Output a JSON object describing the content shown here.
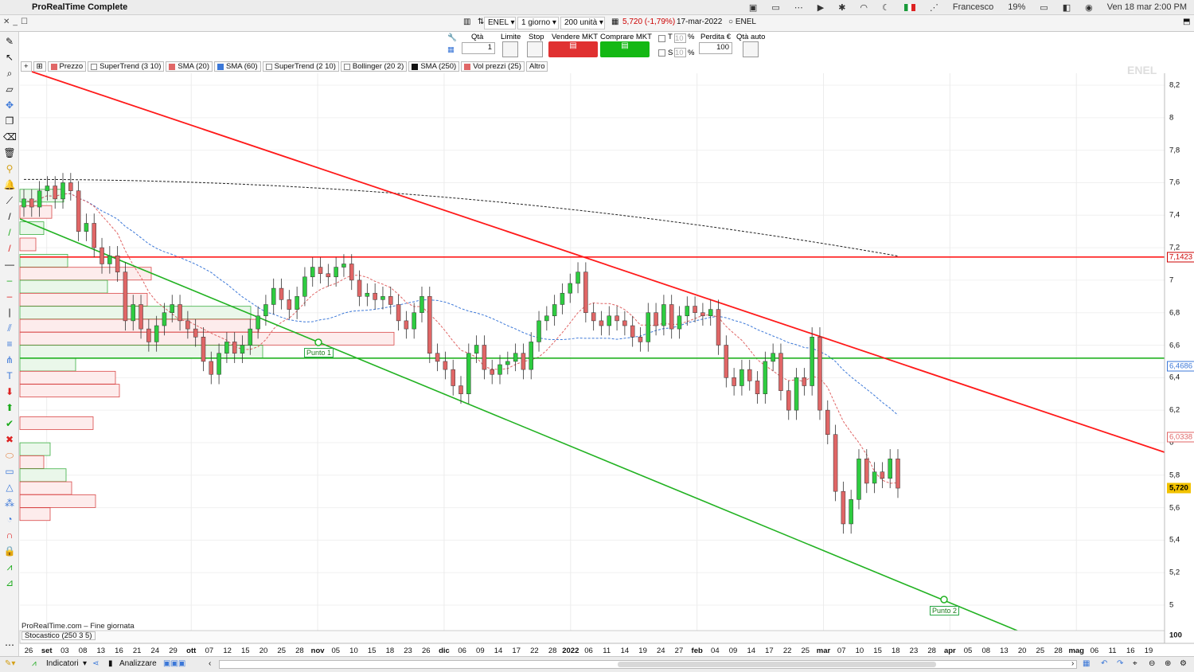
{
  "menubar": {
    "app_name": "ProRealTime Complete",
    "user": "Francesco",
    "battery": "19%",
    "datetime": "Ven 18 mar  2:00 PM"
  },
  "toolbar": {
    "symbol": "ENEL",
    "timeframe": "1 giorno",
    "units": "200 unità",
    "quote": "5,720 (-1,79%)",
    "quote_color": "#cc0000",
    "date": "17-mar-2022",
    "instrument": "ENEL"
  },
  "order": {
    "qty_label": "Qtà",
    "qty_value": "1",
    "limit_label": "Limite",
    "stop_label": "Stop",
    "sell_label": "Vendere MKT",
    "buy_label": "Comprare MKT",
    "t_label": "T",
    "s_label": "S",
    "t_value": "10",
    "s_value": "10",
    "pct": "%",
    "loss_label": "Perdita €",
    "loss_value": "100",
    "auto_qty_label": "Qtà auto"
  },
  "legend": [
    {
      "label": "Prezzo",
      "color": "#e06666"
    },
    {
      "label": "SuperTrend (3 10)",
      "color": "#ffffff"
    },
    {
      "label": "SMA (20)",
      "color": "#e06666"
    },
    {
      "label": "SMA (60)",
      "color": "#3c78d8"
    },
    {
      "label": "SuperTrend (2 10)",
      "color": "#ffffff"
    },
    {
      "label": "Bollinger (20 2)",
      "color": "#ffffff"
    },
    {
      "label": "SMA (250)",
      "color": "#111111"
    },
    {
      "label": "Vol prezzi (25)",
      "color": "#e06666"
    },
    {
      "label": "Altro",
      "color": ""
    }
  ],
  "watermark": "ENEL",
  "footer": {
    "source": "ProRealTime.com – Fine giornata",
    "stochastic": "Stocastico (250 3 5)",
    "stoch_value": "100"
  },
  "bottombar": {
    "indicators": "Indicatori",
    "analyzer": "Analizzare"
  },
  "annotations": {
    "point1": "Punto 1",
    "point2": "Punto 2"
  },
  "chart_data": {
    "type": "candlestick",
    "title": "",
    "ylim": [
      4.9,
      8.3
    ],
    "y_ticks": [
      "8,2",
      "8",
      "7,8",
      "7,6",
      "7,4",
      "7,2",
      "7",
      "6,8",
      "6,6",
      "6,4",
      "6,2",
      "6",
      "5,8",
      "5,6",
      "5,4",
      "5,2",
      "5"
    ],
    "y_tags": [
      {
        "label": "7,1423",
        "value": 7.1423,
        "color": "#cc0000"
      },
      {
        "label": "6,4686",
        "value": 6.4686,
        "color": "#3c78d8"
      },
      {
        "label": "6,0338",
        "value": 6.0338,
        "color": "#e06666"
      },
      {
        "label": "5,720",
        "value": 5.72,
        "color": "#f2c200"
      }
    ],
    "x_ticks": [
      {
        "label": "26",
        "bold": false
      },
      {
        "label": "set",
        "bold": true
      },
      {
        "label": "03",
        "bold": false
      },
      {
        "label": "08",
        "bold": false
      },
      {
        "label": "13",
        "bold": false
      },
      {
        "label": "16",
        "bold": false
      },
      {
        "label": "21",
        "bold": false
      },
      {
        "label": "24",
        "bold": false
      },
      {
        "label": "29",
        "bold": false
      },
      {
        "label": "ott",
        "bold": true
      },
      {
        "label": "07",
        "bold": false
      },
      {
        "label": "12",
        "bold": false
      },
      {
        "label": "15",
        "bold": false
      },
      {
        "label": "20",
        "bold": false
      },
      {
        "label": "25",
        "bold": false
      },
      {
        "label": "28",
        "bold": false
      },
      {
        "label": "nov",
        "bold": true
      },
      {
        "label": "05",
        "bold": false
      },
      {
        "label": "10",
        "bold": false
      },
      {
        "label": "15",
        "bold": false
      },
      {
        "label": "18",
        "bold": false
      },
      {
        "label": "23",
        "bold": false
      },
      {
        "label": "26",
        "bold": false
      },
      {
        "label": "dic",
        "bold": true
      },
      {
        "label": "06",
        "bold": false
      },
      {
        "label": "09",
        "bold": false
      },
      {
        "label": "14",
        "bold": false
      },
      {
        "label": "17",
        "bold": false
      },
      {
        "label": "22",
        "bold": false
      },
      {
        "label": "28",
        "bold": false
      },
      {
        "label": "2022",
        "bold": true
      },
      {
        "label": "06",
        "bold": false
      },
      {
        "label": "11",
        "bold": false
      },
      {
        "label": "14",
        "bold": false
      },
      {
        "label": "19",
        "bold": false
      },
      {
        "label": "24",
        "bold": false
      },
      {
        "label": "27",
        "bold": false
      },
      {
        "label": "feb",
        "bold": true
      },
      {
        "label": "04",
        "bold": false
      },
      {
        "label": "09",
        "bold": false
      },
      {
        "label": "14",
        "bold": false
      },
      {
        "label": "17",
        "bold": false
      },
      {
        "label": "22",
        "bold": false
      },
      {
        "label": "25",
        "bold": false
      },
      {
        "label": "mar",
        "bold": true
      },
      {
        "label": "07",
        "bold": false
      },
      {
        "label": "10",
        "bold": false
      },
      {
        "label": "15",
        "bold": false
      },
      {
        "label": "18",
        "bold": false
      },
      {
        "label": "23",
        "bold": false
      },
      {
        "label": "28",
        "bold": false
      },
      {
        "label": "apr",
        "bold": true
      },
      {
        "label": "05",
        "bold": false
      },
      {
        "label": "08",
        "bold": false
      },
      {
        "label": "13",
        "bold": false
      },
      {
        "label": "20",
        "bold": false
      },
      {
        "label": "25",
        "bold": false
      },
      {
        "label": "28",
        "bold": false
      },
      {
        "label": "mag",
        "bold": true
      },
      {
        "label": "06",
        "bold": false
      },
      {
        "label": "11",
        "bold": false
      },
      {
        "label": "16",
        "bold": false
      },
      {
        "label": "19",
        "bold": false
      }
    ],
    "closes": [
      7.5,
      7.45,
      7.55,
      7.58,
      7.5,
      7.6,
      7.55,
      7.3,
      7.35,
      7.2,
      7.1,
      7.15,
      7.05,
      6.75,
      6.85,
      6.7,
      6.62,
      6.72,
      6.8,
      6.85,
      6.75,
      6.7,
      6.65,
      6.5,
      6.42,
      6.55,
      6.62,
      6.55,
      6.6,
      6.7,
      6.78,
      6.85,
      6.95,
      6.88,
      6.82,
      6.9,
      7.02,
      7.08,
      7.04,
      7.02,
      7.08,
      7.1,
      7.0,
      6.9,
      6.92,
      6.88,
      6.9,
      6.85,
      6.75,
      6.7,
      6.8,
      6.9,
      6.55,
      6.5,
      6.45,
      6.35,
      6.3,
      6.55,
      6.6,
      6.45,
      6.42,
      6.48,
      6.5,
      6.55,
      6.45,
      6.62,
      6.75,
      6.78,
      6.85,
      6.92,
      6.98,
      7.05,
      6.8,
      6.75,
      6.72,
      6.78,
      6.75,
      6.72,
      6.65,
      6.62,
      6.8,
      6.72,
      6.85,
      6.7,
      6.78,
      6.84,
      6.8,
      6.78,
      6.82,
      6.6,
      6.4,
      6.35,
      6.45,
      6.38,
      6.3,
      6.5,
      6.55,
      6.32,
      6.2,
      6.4,
      6.35,
      6.65,
      6.2,
      6.05,
      5.7,
      5.5,
      5.65,
      5.9,
      5.75,
      5.82,
      5.78,
      5.9,
      5.72
    ],
    "horizontal_lines": [
      {
        "value": 7.1423,
        "color": "#ff1a1a"
      },
      {
        "value": 6.52,
        "color": "#22b222"
      }
    ]
  }
}
